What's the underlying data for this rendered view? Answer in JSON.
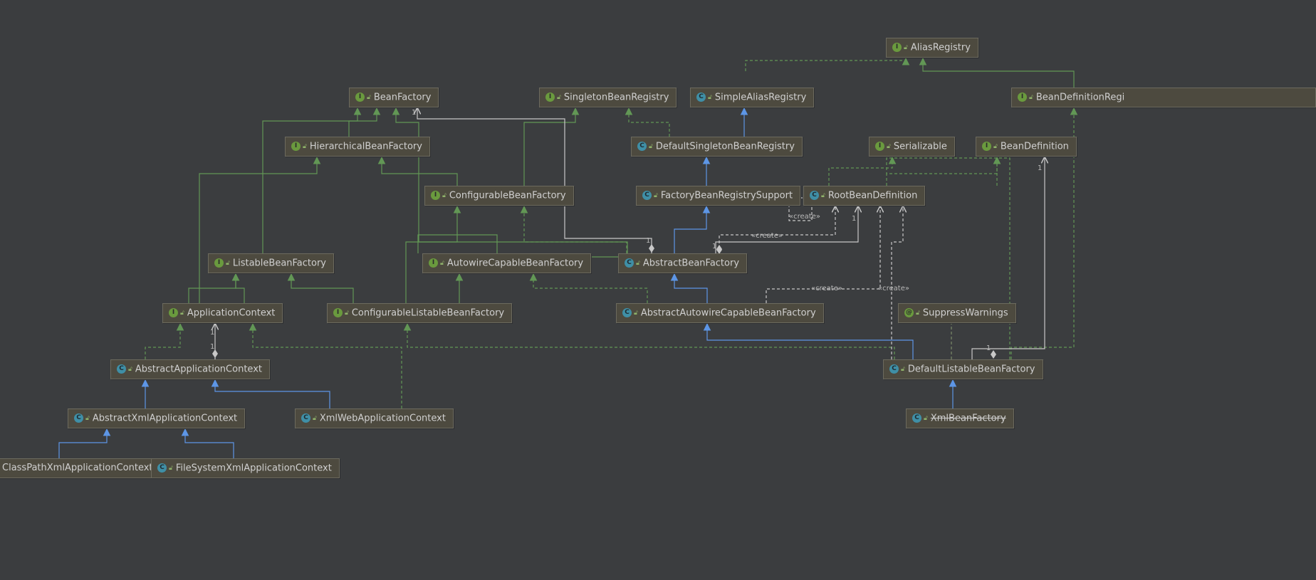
{
  "nodes": [
    {
      "id": "aliasregistry",
      "label": "AliasRegistry",
      "kind": "interface"
    },
    {
      "id": "beanfactory",
      "label": "BeanFactory",
      "kind": "interface"
    },
    {
      "id": "singletonbeanregistry",
      "label": "SingletonBeanRegistry",
      "kind": "interface"
    },
    {
      "id": "simplealiasregistry",
      "label": "SimpleAliasRegistry",
      "kind": "class"
    },
    {
      "id": "beandefinitionregistry",
      "label": "BeanDefinitionRegi",
      "kind": "interface"
    },
    {
      "id": "hierarchicalbeanfactory",
      "label": "HierarchicalBeanFactory",
      "kind": "interface"
    },
    {
      "id": "defaultsingletonbeanregistry",
      "label": "DefaultSingletonBeanRegistry",
      "kind": "class"
    },
    {
      "id": "serializable",
      "label": "Serializable",
      "kind": "interface"
    },
    {
      "id": "beandefinition",
      "label": "BeanDefinition",
      "kind": "interface"
    },
    {
      "id": "configurablebeanfactory",
      "label": "ConfigurableBeanFactory",
      "kind": "interface"
    },
    {
      "id": "factorybeanregistrysupport",
      "label": "FactoryBeanRegistrySupport",
      "kind": "class"
    },
    {
      "id": "rootbeandefinition",
      "label": "RootBeanDefinition",
      "kind": "class"
    },
    {
      "id": "listablebeanfactory",
      "label": "ListableBeanFactory",
      "kind": "interface"
    },
    {
      "id": "autowirecapablebeanfactory",
      "label": "AutowireCapableBeanFactory",
      "kind": "interface"
    },
    {
      "id": "abstractbeanfactory",
      "label": "AbstractBeanFactory",
      "kind": "class"
    },
    {
      "id": "applicationcontext",
      "label": "ApplicationContext",
      "kind": "interface"
    },
    {
      "id": "configurablelistablebeanfactory",
      "label": "ConfigurableListableBeanFactory",
      "kind": "interface"
    },
    {
      "id": "abstractautowirecapablebeanfactory",
      "label": "AbstractAutowireCapableBeanFactory",
      "kind": "class"
    },
    {
      "id": "suppresswarnings",
      "label": "SuppressWarnings",
      "kind": "annotation"
    },
    {
      "id": "abstractapplicationcontext",
      "label": "AbstractApplicationContext",
      "kind": "class"
    },
    {
      "id": "defaultlistablebeanfactory",
      "label": "DefaultListableBeanFactory",
      "kind": "class"
    },
    {
      "id": "abstractxmlapplicationcontext",
      "label": "AbstractXmlApplicationContext",
      "kind": "class"
    },
    {
      "id": "xmlwebapplicationcontext",
      "label": "XmlWebApplicationContext",
      "kind": "class"
    },
    {
      "id": "xmlbeanfactory",
      "label": "XmlBeanFactory",
      "kind": "class",
      "deprecated": true
    },
    {
      "id": "classpathxmlapplicationcontext",
      "label": "ClassPathXmlApplicationContext",
      "kind": "class"
    },
    {
      "id": "filesystemxmlapplicationcontext",
      "label": "FileSystemXmlApplicationContext",
      "kind": "class"
    }
  ],
  "edge_labels": {
    "create": "«create»",
    "one": "1"
  },
  "icons": {
    "interface": "I",
    "class": "C",
    "annotation": "@",
    "visibility": "unlock-icon"
  },
  "colors": {
    "background": "#3b3d3f",
    "node_fill": "#4d4a3f",
    "implements_edge": "#629755",
    "extends_edge": "#5d96e6",
    "association_edge": "#c8c8c8"
  }
}
